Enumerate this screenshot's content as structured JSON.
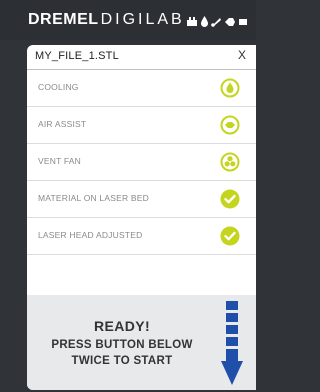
{
  "brand": {
    "part1": "DREMEL",
    "part2": "DIGILAB"
  },
  "status_icons": [
    "fan-icon",
    "flame-icon",
    "laser-icon",
    "air-assist-icon",
    "battery-icon"
  ],
  "dialog": {
    "file_name": "MY_FILE_1.STL",
    "close_label": "X",
    "checks": [
      {
        "label": "COOLING",
        "icon": "cooling-drop-icon",
        "state": "pending"
      },
      {
        "label": "AIR ASSIST",
        "icon": "air-assist-icon",
        "state": "pending"
      },
      {
        "label": "VENT FAN",
        "icon": "vent-fan-icon",
        "state": "pending"
      },
      {
        "label": "MATERIAL ON LASER BED",
        "icon": "check-icon",
        "state": "done"
      },
      {
        "label": "LASER HEAD ADJUSTED",
        "icon": "check-icon",
        "state": "done"
      }
    ]
  },
  "footer": {
    "ready": "READY!",
    "instruction_line1": "PRESS BUTTON BELOW",
    "instruction_line2": "TWICE TO START"
  },
  "colors": {
    "accent_yellow": "#c5d41c",
    "arrow_blue": "#1f4fa8",
    "background": "#303337"
  }
}
